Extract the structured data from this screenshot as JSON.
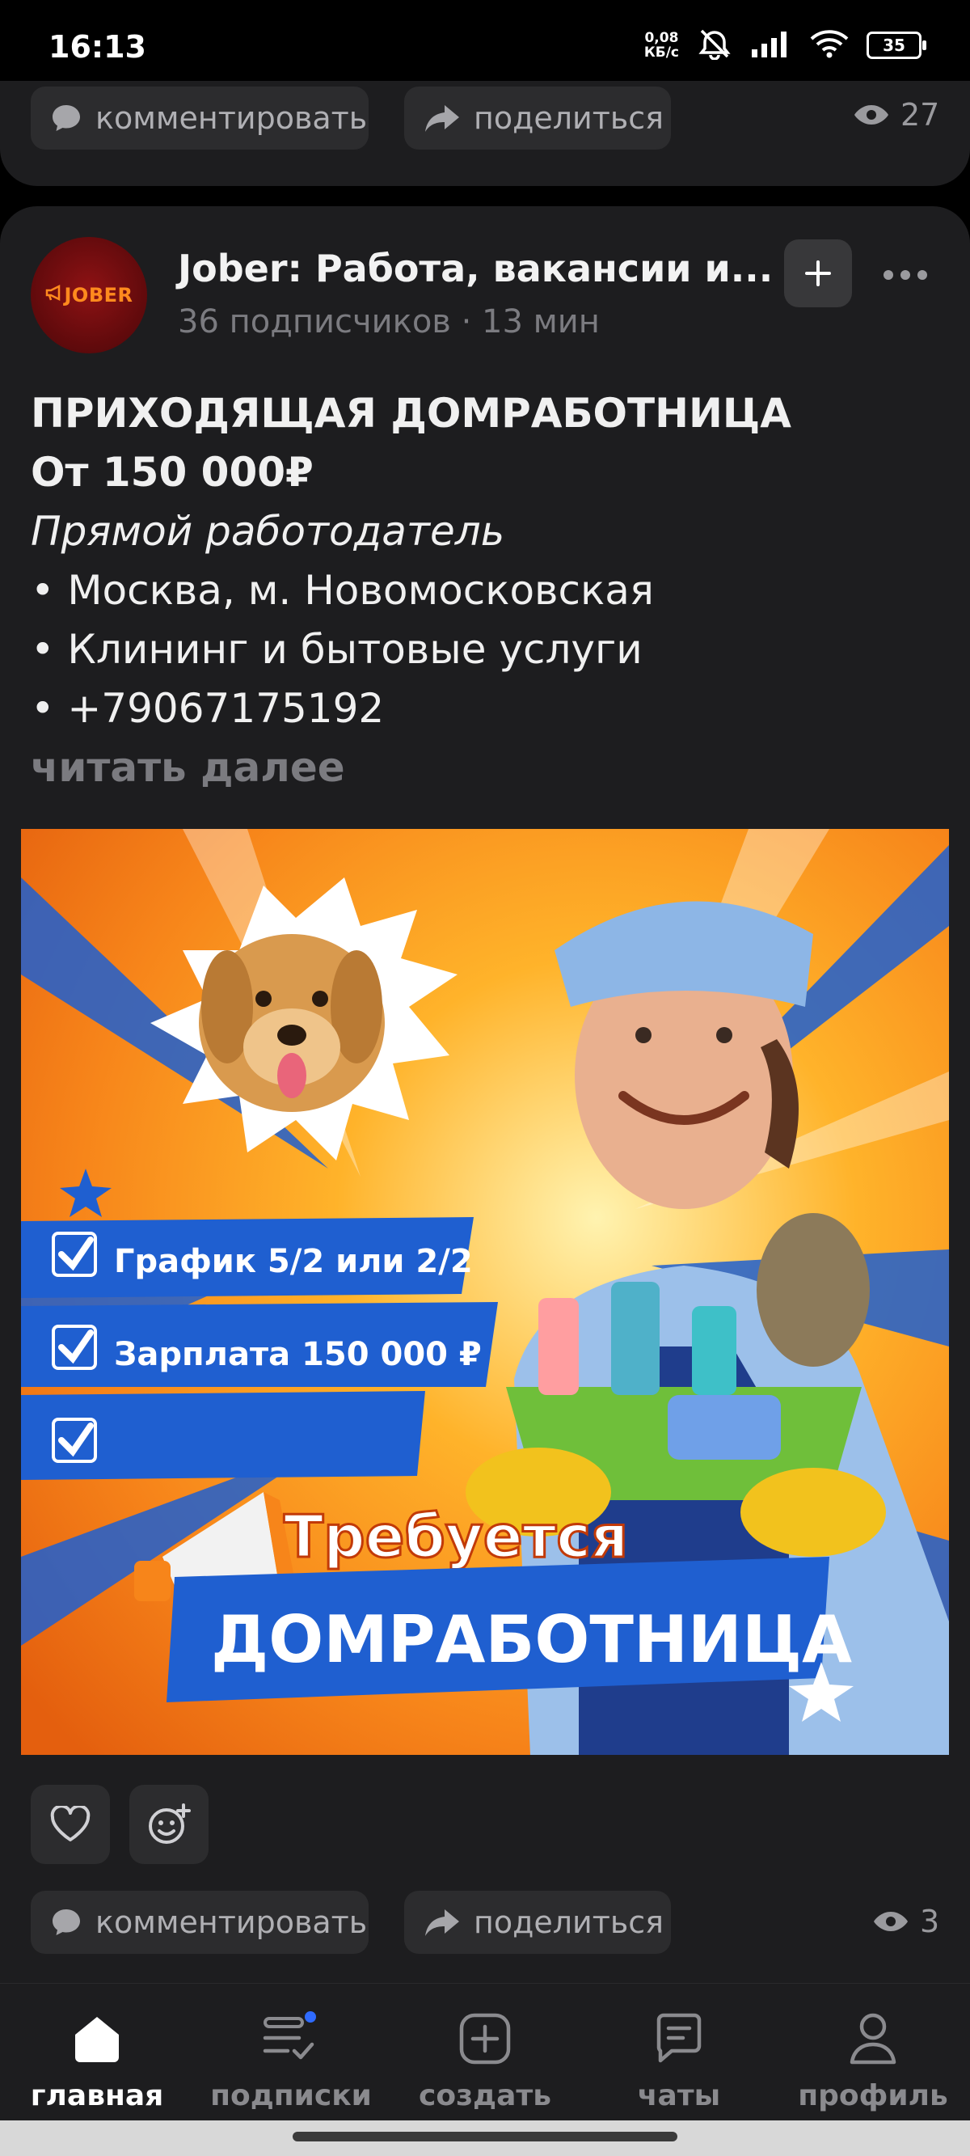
{
  "status_bar": {
    "time": "16:13",
    "net_speed_value": "0,08",
    "net_speed_unit": "КБ/с",
    "battery": "35"
  },
  "previous_post": {
    "comment_label": "комментировать",
    "share_label": "поделиться",
    "views": "27"
  },
  "post": {
    "avatar_text": "JOBER",
    "channel_name": "Jober: Работа, вакансии и...",
    "channel_meta": "36 подписчиков · 13 мин",
    "title": "ПРИХОДЯЩАЯ ДОМРАБОТНИЦА",
    "salary": "От 150 000₽",
    "employer": "Прямой работодатель",
    "bullets": [
      "• Москва, м. Новомосковская",
      "• Клининг и бытовые услуги",
      "• +79067175192"
    ],
    "read_more": "читать далее",
    "image": {
      "line1": "График 5/2 или 2/2",
      "line2": "Зарплата 150 000 ₽",
      "headline1": "Требуется",
      "headline2": "ДОМРАБОТНИЦА"
    },
    "comment_label": "комментировать",
    "share_label": "поделиться",
    "views": "3"
  },
  "nav": {
    "items": [
      {
        "label": "главная",
        "icon": "home-icon"
      },
      {
        "label": "подписки",
        "icon": "subscriptions-icon"
      },
      {
        "label": "создать",
        "icon": "create-icon"
      },
      {
        "label": "чаты",
        "icon": "chats-icon"
      },
      {
        "label": "профиль",
        "icon": "profile-icon"
      }
    ]
  },
  "colors": {
    "background": "#000000",
    "card": "#1d1d1f",
    "pill": "#2c2c2e",
    "muted_text": "#7b7b80",
    "badge_dot": "#2f6bff"
  }
}
